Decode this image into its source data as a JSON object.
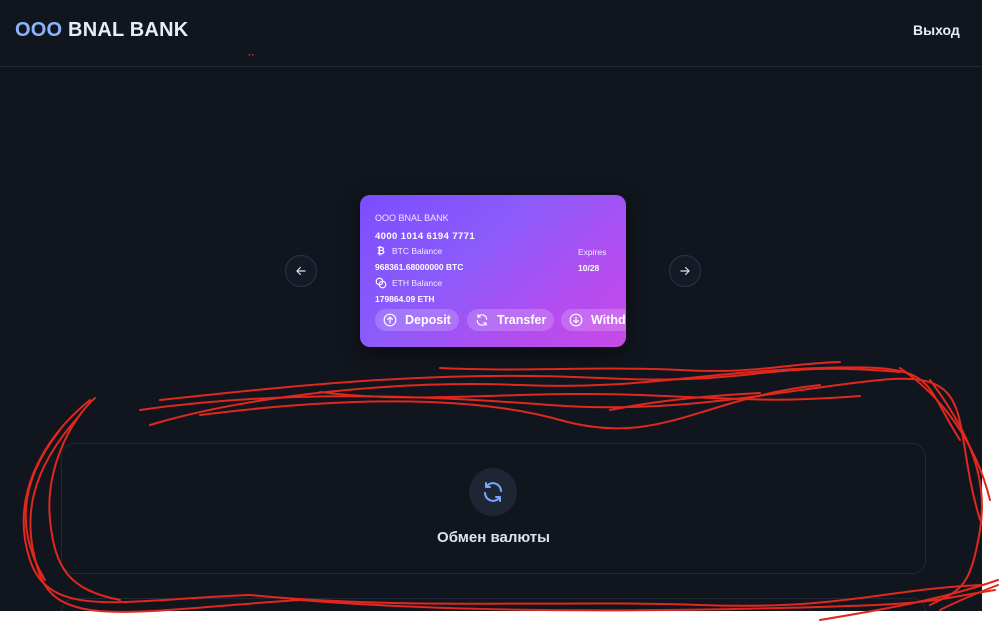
{
  "header": {
    "brand_part1": "OOO",
    "brand_part2": "BNAL BANK",
    "logout_label": "Выход"
  },
  "card": {
    "bank_name": "OOO BNAL BANK",
    "number": "4000 1014 6194 7771",
    "btc_label": "BTC Balance",
    "btc_value": "968361.68000000 BTC",
    "eth_label": "ETH Balance",
    "eth_value": "179864.09 ETH",
    "expires_label": "Expires",
    "expires_value": "10/28",
    "actions": [
      {
        "label": "Deposit",
        "icon": "arrow-up-circle-icon"
      },
      {
        "label": "Transfer",
        "icon": "refresh-icon"
      },
      {
        "label": "Withdraw",
        "icon": "arrow-down-circle-icon"
      }
    ]
  },
  "exchange": {
    "title": "Обмен валюты",
    "icon": "refresh-icon"
  },
  "colors": {
    "background": "#11151d",
    "brand_accent": "#8ab4ff",
    "card_gradient_start": "#7b4dff",
    "card_gradient_end": "#c949e6",
    "scribble": "#e0281f"
  }
}
